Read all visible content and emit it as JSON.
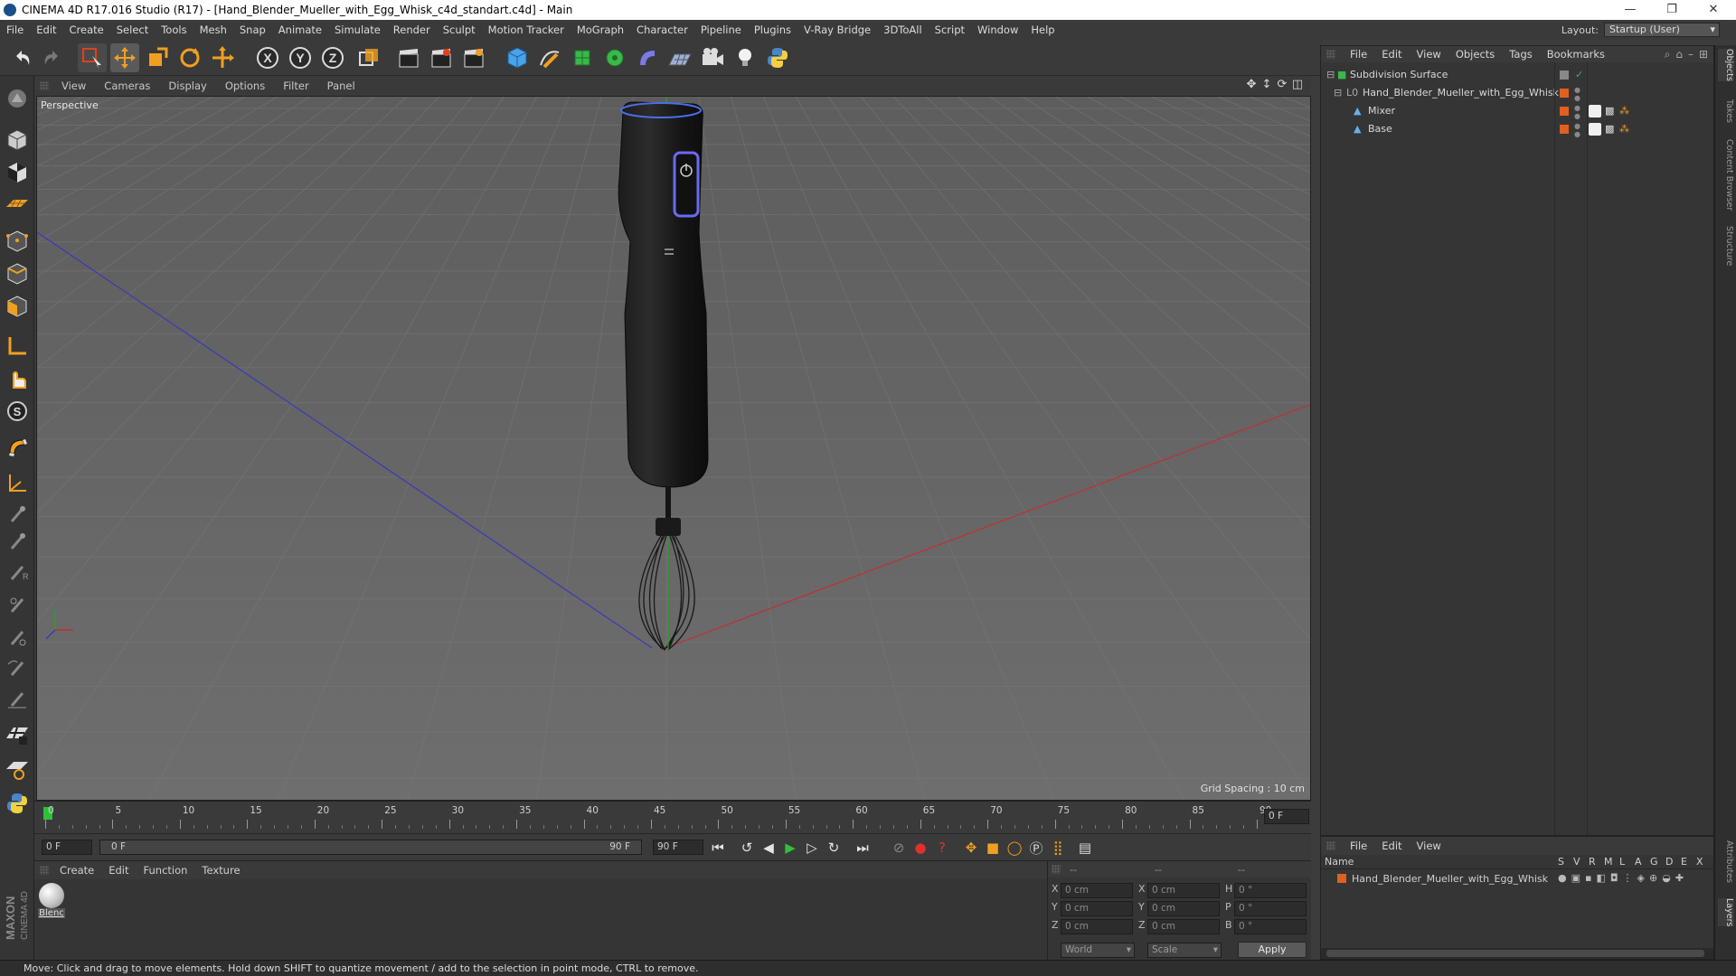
{
  "window": {
    "title": "CINEMA 4D R17.016 Studio (R17) - [Hand_Blender_Mueller_with_Egg_Whisk_c4d_standart.c4d] - Main",
    "controls": {
      "minimize": "—",
      "restore": "❐",
      "close": "✕"
    }
  },
  "menubar": {
    "items": [
      "File",
      "Edit",
      "Create",
      "Select",
      "Tools",
      "Mesh",
      "Snap",
      "Animate",
      "Simulate",
      "Render",
      "Sculpt",
      "Motion Tracker",
      "MoGraph",
      "Character",
      "Pipeline",
      "Plugins",
      "V-Ray Bridge",
      "3DToAll",
      "Script",
      "Window",
      "Help"
    ]
  },
  "layout": {
    "label": "Layout:",
    "value": "Startup (User)"
  },
  "toolbar": {
    "axis_x": "X",
    "axis_y": "Y",
    "axis_z": "Z"
  },
  "viewport": {
    "menu": [
      "View",
      "Cameras",
      "Display",
      "Options",
      "Filter",
      "Panel"
    ],
    "label": "Perspective",
    "grid_spacing": "Grid Spacing : 10 cm"
  },
  "timeline": {
    "ticks": [
      "0",
      "5",
      "10",
      "15",
      "20",
      "25",
      "30",
      "35",
      "40",
      "45",
      "50",
      "55",
      "60",
      "65",
      "70",
      "75",
      "80",
      "85",
      "90"
    ],
    "current_frame": "0 F"
  },
  "transport": {
    "start_field": "0 F",
    "slider_start": "0 F",
    "slider_end": "90 F",
    "end_field": "90 F"
  },
  "material_panel": {
    "menu": [
      "Create",
      "Edit",
      "Function",
      "Texture"
    ],
    "materials": [
      {
        "name": "Blenc"
      }
    ]
  },
  "coords": {
    "headers": [
      "--",
      "--",
      "--"
    ],
    "rows": [
      {
        "axis": "X",
        "pos": "0 cm",
        "axis2": "X",
        "size": "0 cm",
        "rot_label": "H",
        "rot": "0 °"
      },
      {
        "axis": "Y",
        "pos": "0 cm",
        "axis2": "Y",
        "size": "0 cm",
        "rot_label": "P",
        "rot": "0 °"
      },
      {
        "axis": "Z",
        "pos": "0 cm",
        "axis2": "Z",
        "size": "0 cm",
        "rot_label": "B",
        "rot": "0 °"
      }
    ],
    "mode": "World",
    "transform": "Scale",
    "apply": "Apply"
  },
  "object_manager": {
    "menu": [
      "File",
      "Edit",
      "View",
      "Objects",
      "Tags",
      "Bookmarks"
    ],
    "objects": [
      {
        "name": "Subdivision Surface"
      },
      {
        "name": "Hand_Blender_Mueller_with_Egg_Whisk"
      },
      {
        "name": "Mixer"
      },
      {
        "name": "Base"
      }
    ]
  },
  "attribute_manager": {
    "menu": [
      "File",
      "Edit",
      "View"
    ],
    "columns": [
      "Name",
      "S",
      "V",
      "R",
      "M",
      "L",
      "A",
      "G",
      "D",
      "E",
      "X"
    ],
    "row_name": "Hand_Blender_Mueller_with_Egg_Whisk"
  },
  "right_tabs": [
    "Objects",
    "Takes",
    "Content Browser",
    "Structure",
    "Attributes",
    "Layers"
  ],
  "branding": {
    "logo": "MAXON CINEMA 4D"
  },
  "status": {
    "text": "Move: Click and drag to move elements. Hold down SHIFT to quantize movement / add to the selection in point mode, CTRL to remove."
  },
  "colors": {
    "accent_orange": "#f0a020",
    "selection_blue": "#4a6fa5",
    "axis_x": "#c03030",
    "axis_z": "#3040b0",
    "axis_y": "#2aa02a"
  }
}
